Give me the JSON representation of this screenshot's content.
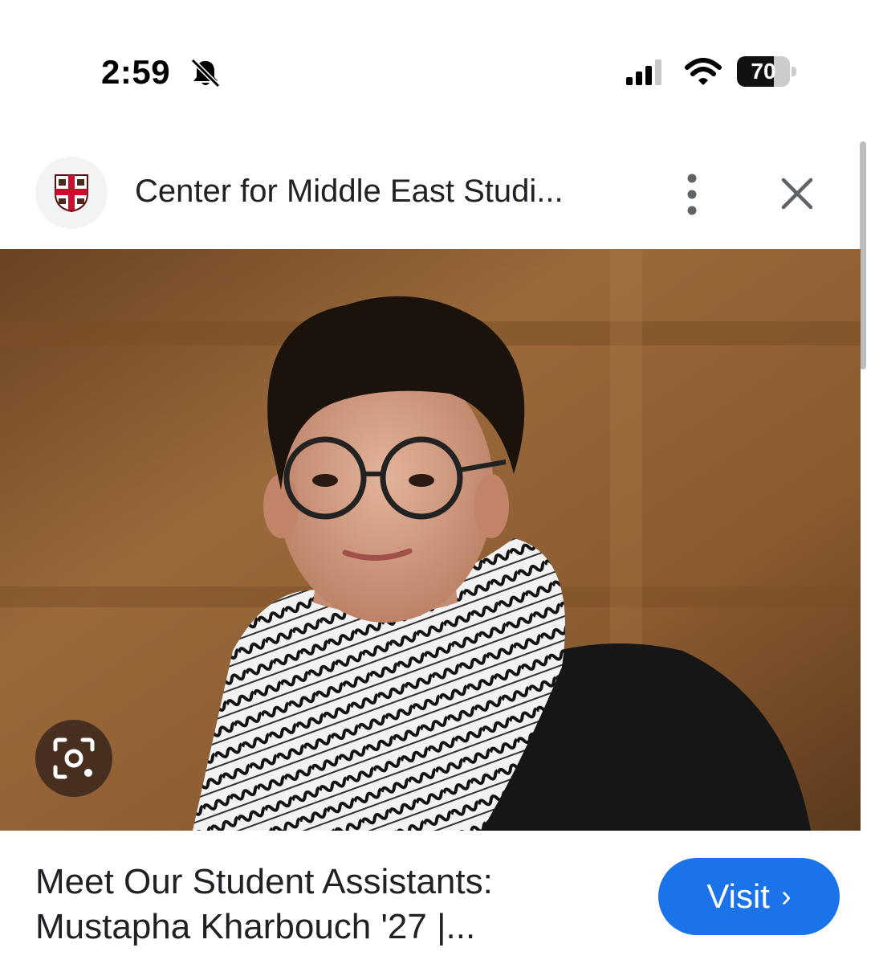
{
  "status_bar": {
    "time": "2:59",
    "battery_level": "70",
    "battery_fraction": 0.7,
    "icons": [
      "bell-muted-icon",
      "cellular-signal-icon",
      "wifi-icon",
      "battery-icon"
    ]
  },
  "header": {
    "site_title": "Center for Middle East Studi...",
    "logo_icon": "university-shield-icon",
    "more_icon": "more-vertical-icon",
    "close_icon": "close-icon"
  },
  "image": {
    "lens_icon": "visual-search-icon"
  },
  "result": {
    "title_line1": "Meet Our Student Assistants:",
    "title_line2": "Mustapha Kharbouch '27 |...",
    "visit_label": "Visit",
    "visit_chevron": "›"
  },
  "colors": {
    "accent": "#1a73e8",
    "shield_red": "#c8102e",
    "background_brown": "#8a5a2e"
  }
}
